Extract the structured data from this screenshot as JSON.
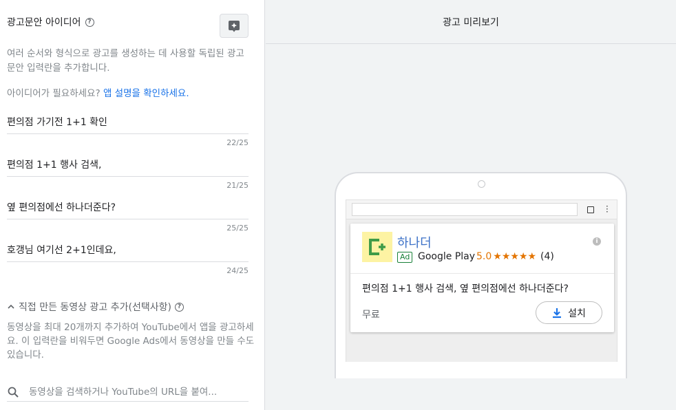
{
  "left": {
    "header": {
      "title": "광고문안 아이디어"
    },
    "description": "여러 순서와 형식으로 광고를 생성하는 데 사용할 독립된 광고문안 입력란을 추가합니다.",
    "idea_prompt": {
      "text": "아이디어가 필요하세요?",
      "link": "앱 설명을 확인하세요."
    },
    "fields": [
      {
        "value": "편의점 가기전 1+1 확인",
        "count": "22/25"
      },
      {
        "value": "편의점 1+1 행사 검색,",
        "count": "21/25"
      },
      {
        "value": "옆 편의점에선 하나더준다?",
        "count": "25/25"
      },
      {
        "value": "호갱님 여기선 2+1인데요,",
        "count": "24/25"
      }
    ],
    "video": {
      "header": "직접 만든 동영상 광고 추가(선택사항)",
      "description": "동영상을 최대 20개까지 추가하여 YouTube에서 앱을 광고하세요. 이 입력란을 비워두면 Google Ads에서 동영상을 만들 수도 있습니다.",
      "search_placeholder": "동영상을 검색하거나 YouTube의 URL을 붙여..."
    }
  },
  "preview": {
    "title": "광고 미리보기",
    "ad": {
      "app_name": "하나더",
      "badge": "Ad",
      "store": "Google Play",
      "rating": "5.0",
      "stars": "★★★★★",
      "reviews": "(4)",
      "headline": "편의점 1+1 행사 검색, 옆 편의점에선 하나더준다?",
      "price": "무료",
      "install_label": "설치"
    }
  },
  "colors": {
    "accent": "#1a73e8",
    "rating": "#e37400",
    "ad_badge": "#188038",
    "app_name": "#3c71c7"
  }
}
